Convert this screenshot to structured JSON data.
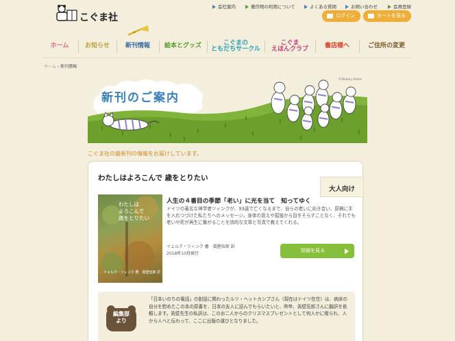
{
  "header": {
    "logo_text": "こぐま社",
    "links": [
      {
        "label": "会社案内",
        "color": "blue"
      },
      {
        "label": "著作物の利用について",
        "color": "green"
      },
      {
        "label": "よくある質問",
        "color": "blue"
      },
      {
        "label": "お問い合わせ",
        "color": "blue"
      },
      {
        "label": "会員登録",
        "color": "blue"
      }
    ],
    "login_label": "ログイン",
    "cart_label": "カートを見る"
  },
  "nav": {
    "items": [
      {
        "label": "ホーム",
        "color": "#e36b8a",
        "active": true
      },
      {
        "label": "お知らせ",
        "color": "#b9a23a"
      },
      {
        "label": "新刊情報",
        "color": "#3a6ea5"
      },
      {
        "label": "絵本とグッズ",
        "color": "#5a9a2a"
      },
      {
        "label": "こぐまの\nともだちサークル",
        "color": "#2aa3b6"
      },
      {
        "label": "こぐま\nえほんクラブ",
        "color": "#c0407a"
      },
      {
        "label": "書店様へ",
        "color": "#d8402a"
      },
      {
        "label": "ご住所の変更",
        "color": "#7a5a2a"
      }
    ]
  },
  "breadcrumb": {
    "home": "ホーム",
    "current": "新刊情報"
  },
  "banner": {
    "title": "新刊のご案内",
    "credit": "©Nobory Baba"
  },
  "intro": "こぐま社の最新刊の情報をお届けしています。",
  "book": {
    "title": "わたしはよろこんで 歳をとりたい",
    "tag": "大人向け",
    "cover_title": "わたしは\nよろこんで\n歳をとりたい",
    "cover_author": "イェルク・ツィンク 著　眞壁伍郎 訳",
    "subtitle": "人生の４番目の季節「老い」に光を当て　知ってゆく",
    "description": "ドイツの著名な神学者ツィンクが、93歳で亡くなるまで、自らの老いに向き合い、原稿に手を入れつづけた私たちへのメッセージ。身体の衰えや孤独から目をそらすことなく、それでも老いや死が再生に繋がることを詩的な文章と写真で教えてくれる。",
    "author": "イェルク・ツィンク 著　眞壁伍郎 訳",
    "published": "2018年10月発行",
    "detail_label": "詳細を見る"
  },
  "editor": {
    "badge": "編集部\nより",
    "text": "「日本いのちの電話」の創設に関わったルツ・ヘットカンプさん（現在はドイツ在住）は、病床の自分を慰めたこの本の原書を、日本の友人に読んでもらいたいと、昨年、眞壁伍郎さんに翻訳を依頼します。眞壁先生の私訳は、このお二人からのクリスマスプレゼントとして何人かに贈られ、人から人へと伝わって、ここに出版の運びとなりました。"
  }
}
